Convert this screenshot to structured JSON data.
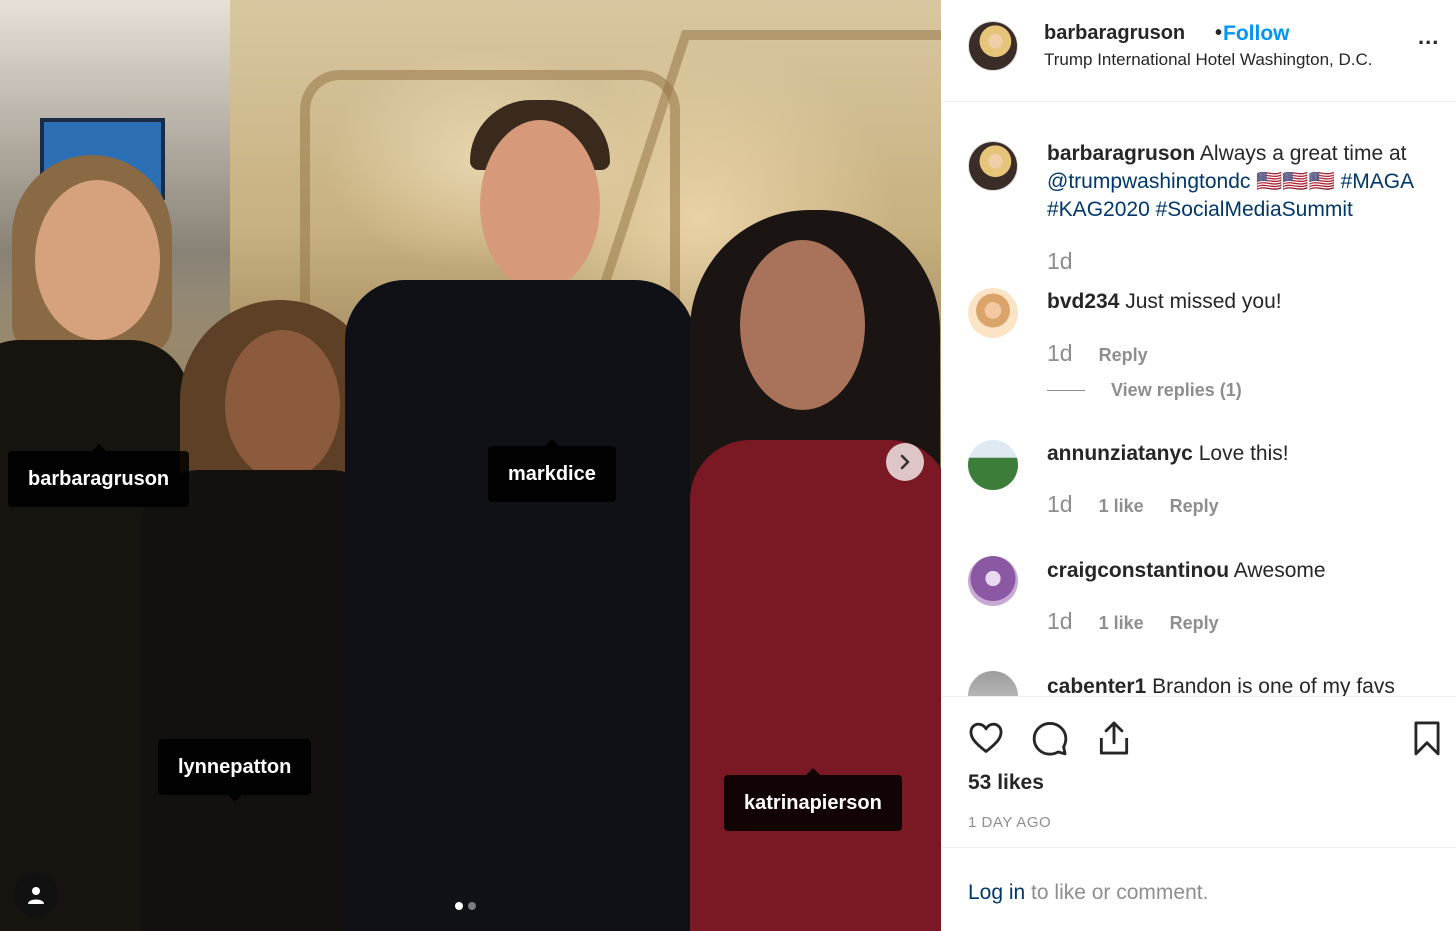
{
  "photo": {
    "tags": [
      {
        "username": "barbaragruson"
      },
      {
        "username": "markdice"
      },
      {
        "username": "lynnepatton"
      },
      {
        "username": "katrinapierson"
      }
    ],
    "carousel": {
      "count": 2,
      "active": 1
    }
  },
  "header": {
    "username": "barbaragruson",
    "separator": "•",
    "follow_label": "Follow",
    "location": "Trump International Hotel Washington, D.C.",
    "more_label": "..."
  },
  "caption": {
    "username": "barbaragruson",
    "text_start": "Always a great time at",
    "mention": "@trumpwashingtondc",
    "flags": "🇺🇸🇺🇸🇺🇸",
    "hashtags_line1": "#MAGA",
    "hashtags_line2": "#KAG2020 #SocialMediaSummit",
    "time": "1d"
  },
  "comments": [
    {
      "username": "bvd234",
      "text": "Just missed you!",
      "time": "1d",
      "likes": "",
      "reply": "Reply",
      "view_replies": "View replies (1)"
    },
    {
      "username": "annunziatanyc",
      "text": "Love this!",
      "time": "1d",
      "likes": "1 like",
      "reply": "Reply"
    },
    {
      "username": "craigconstantinou",
      "text": "Awesome",
      "time": "1d",
      "likes": "1 like",
      "reply": "Reply"
    },
    {
      "username": "cabenter1",
      "text": "Brandon is one of my favs"
    }
  ],
  "actions": {
    "icons": [
      "heart-icon",
      "comment-icon",
      "share-icon",
      "bookmark-icon"
    ],
    "likes": "53 likes",
    "time_ago": "1 DAY AGO"
  },
  "login": {
    "link": "Log in",
    "text": " to like or comment."
  },
  "colors": {
    "link_blue": "#0095f6",
    "text_dark": "#262626",
    "text_muted": "#8e8e8e",
    "hashtag": "#00376b"
  }
}
